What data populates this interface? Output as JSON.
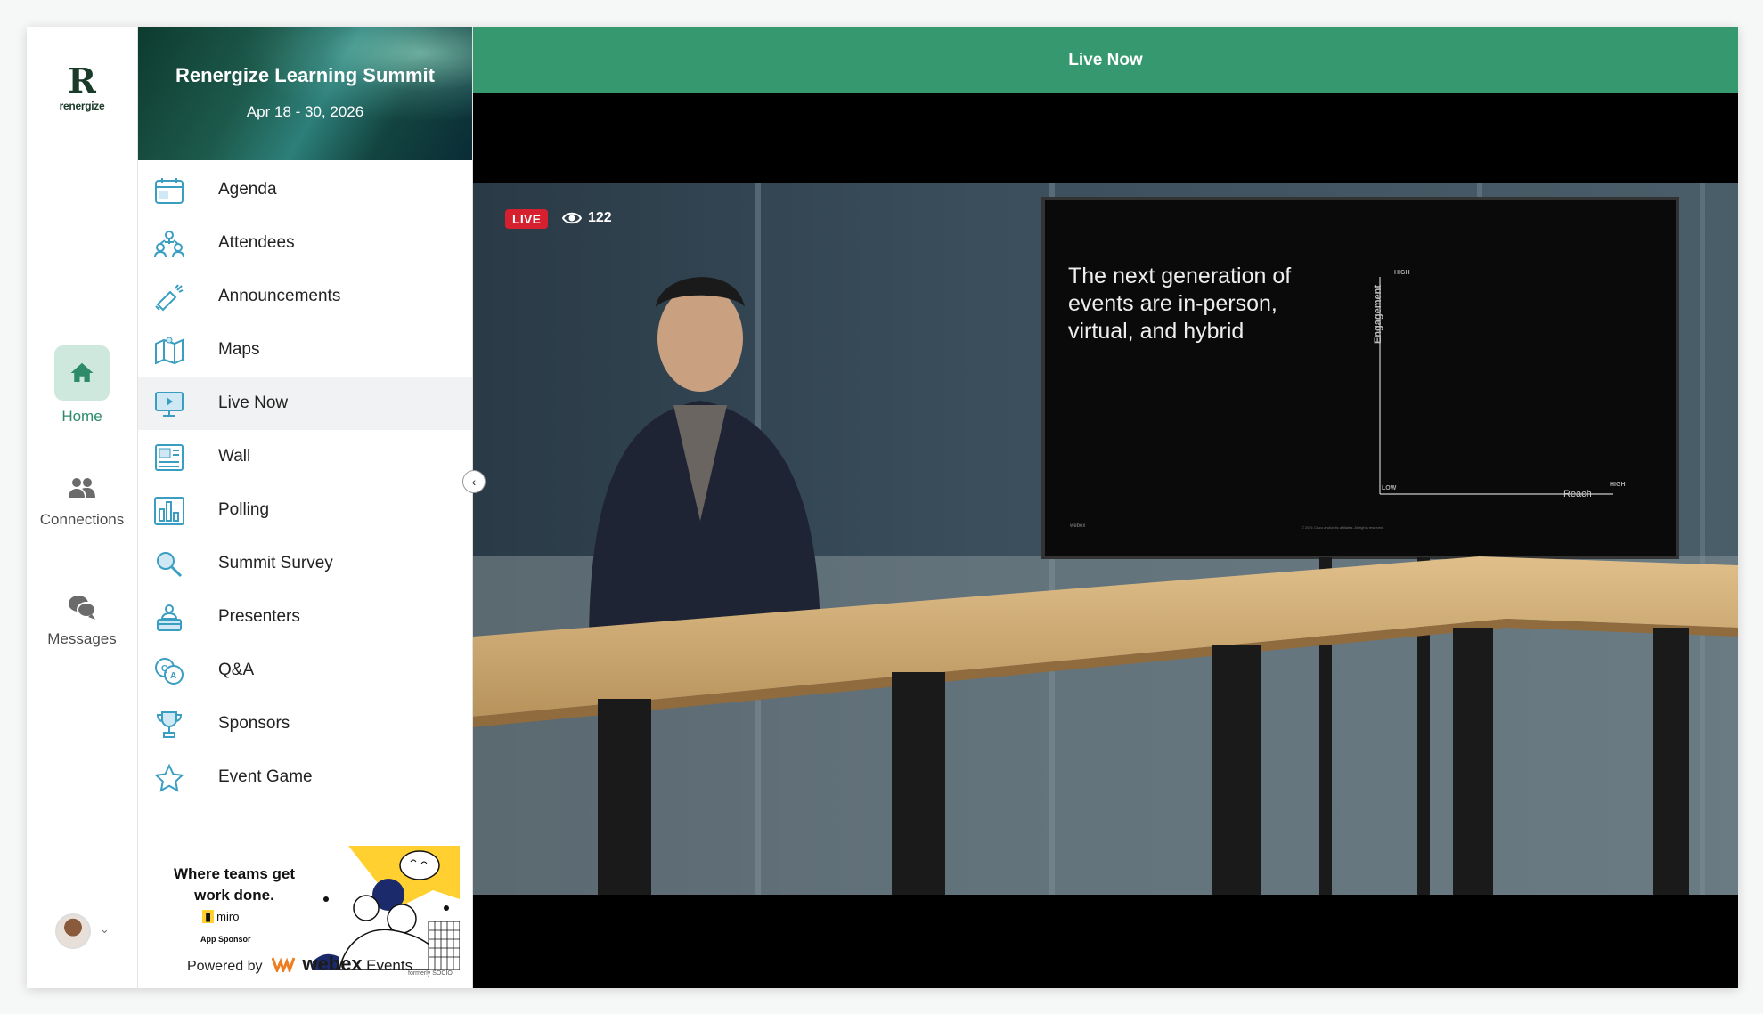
{
  "brand": {
    "mark": "R",
    "name": "renergize"
  },
  "rail": {
    "items": [
      {
        "label": "Home",
        "icon": "home-icon",
        "active": true
      },
      {
        "label": "Connections",
        "icon": "people-icon",
        "active": false
      },
      {
        "label": "Messages",
        "icon": "chat-icon",
        "active": false
      }
    ]
  },
  "event": {
    "title": "Renergize Learning Summit",
    "dates": "Apr 18 - 30, 2026"
  },
  "menu": {
    "items": [
      {
        "label": "Agenda",
        "icon": "calendar-icon"
      },
      {
        "label": "Attendees",
        "icon": "attendees-icon"
      },
      {
        "label": "Announcements",
        "icon": "megaphone-icon"
      },
      {
        "label": "Maps",
        "icon": "map-icon"
      },
      {
        "label": "Live Now",
        "icon": "monitor-play-icon",
        "active": true
      },
      {
        "label": "Wall",
        "icon": "wall-icon"
      },
      {
        "label": "Polling",
        "icon": "bar-chart-icon"
      },
      {
        "label": "Summit Survey",
        "icon": "magnifier-icon"
      },
      {
        "label": "Presenters",
        "icon": "presenter-icon"
      },
      {
        "label": "Q&A",
        "icon": "qa-icon"
      },
      {
        "label": "Sponsors",
        "icon": "trophy-icon"
      },
      {
        "label": "Event Game",
        "icon": "star-icon"
      }
    ]
  },
  "sponsor": {
    "tagline": "Where teams get work done.",
    "brand": "miro",
    "role": "App Sponsor"
  },
  "powered": {
    "prefix": "Powered by",
    "brand": "webex",
    "product": "Events",
    "formerly": "formerly SOCIO"
  },
  "main": {
    "title": "Live Now",
    "live_label": "LIVE",
    "viewer_count": "122",
    "slide": {
      "title": "The next generation of events are in-person, virtual, and hybrid",
      "y_label": "Engagement",
      "x_label": "Reach",
      "high_top": "HIGH",
      "low": "LOW",
      "high_right": "HIGH",
      "footer_left": "webex",
      "footer_right": "© 2021 Cisco and/or its affiliates. All rights reserved."
    }
  },
  "colors": {
    "accent": "#35986e",
    "accent_light": "#cfe8dd",
    "live_red": "#d6202f",
    "icon_teal": "#3a9ec2"
  }
}
